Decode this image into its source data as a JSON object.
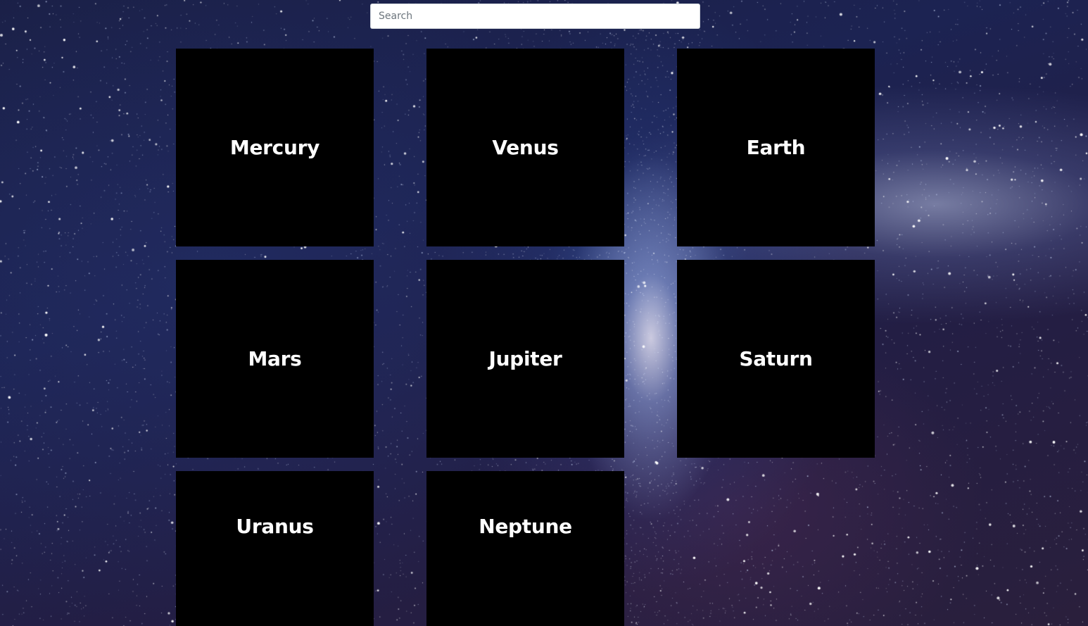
{
  "search": {
    "placeholder": "Search",
    "value": ""
  },
  "planets": [
    {
      "name": "Mercury"
    },
    {
      "name": "Venus"
    },
    {
      "name": "Earth"
    },
    {
      "name": "Mars"
    },
    {
      "name": "Jupiter"
    },
    {
      "name": "Saturn"
    },
    {
      "name": "Uranus"
    },
    {
      "name": "Neptune"
    }
  ],
  "colors": {
    "card_background": "#000000",
    "card_text": "#ffffff",
    "search_background": "#ffffff"
  },
  "background": "starry-night-milky-way"
}
